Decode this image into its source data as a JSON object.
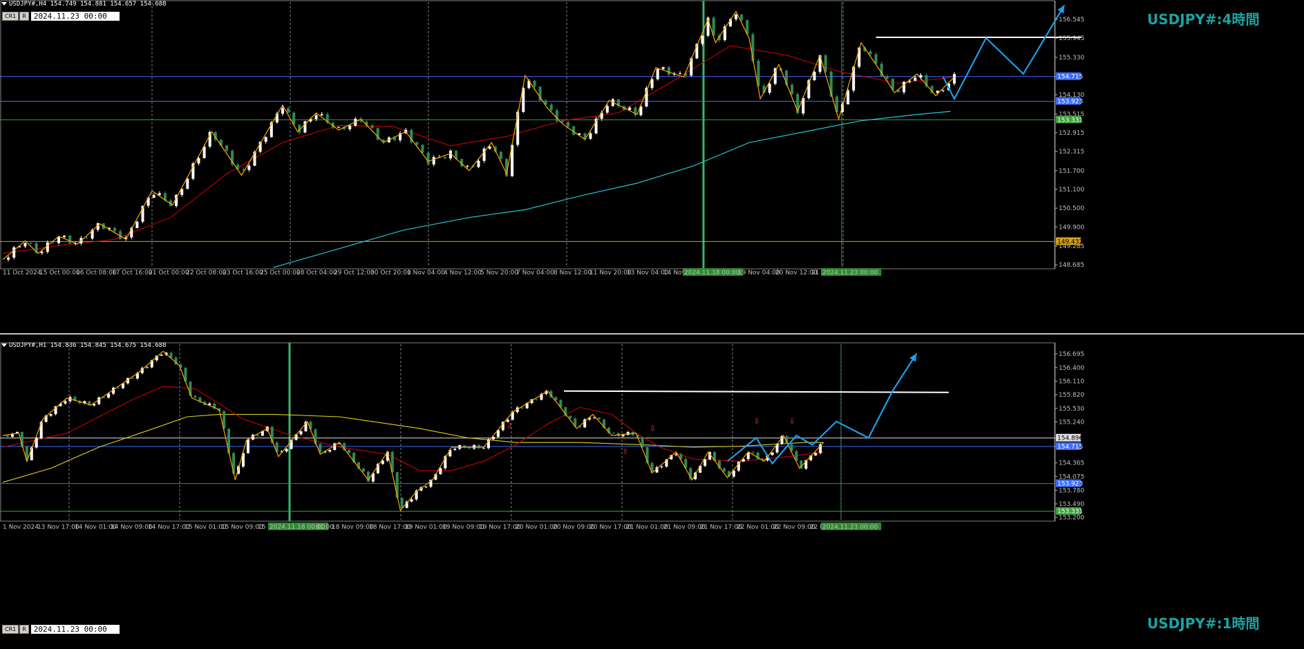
{
  "h4": {
    "header": "USDJPY#,H4  154.749 154.881 154.657 154.688",
    "buttons": [
      "CR1",
      "R"
    ],
    "date_box": "2024.11.23 00:00",
    "title": "USDJPY#:4時間"
  },
  "h1": {
    "header": "USDJPY#,H1  154.836 154.845 154.675 154.688",
    "buttons": [
      "CR1",
      "R"
    ],
    "date_box": "2024.11.23 00:00",
    "title": "USDJPY#:1時間"
  },
  "colors": {
    "background": "#000000",
    "bull": "#ffffff",
    "bear": "#2e8b57",
    "ma_red": "#cc0000",
    "ma_cyan": "#20c8d0",
    "ma_yellow": "#e0d020",
    "zigzag": "#ffa500",
    "forecast": "#1e9ee8",
    "hline_blue": "#3c6cff",
    "hline_green": "#40a040",
    "hline_gold": "#d4a017",
    "vline_green": "#3cb371",
    "title": "#1aa3a3"
  },
  "chart_data": [
    {
      "type": "candlestick",
      "symbol": "USDJPY#",
      "timeframe": "H4",
      "ylim": [
        148.6,
        157.1
      ],
      "y_ticks": [
        156.545,
        155.945,
        155.33,
        154.715,
        154.13,
        153.515,
        152.915,
        152.315,
        151.7,
        151.1,
        150.5,
        149.9,
        149.285,
        148.685
      ],
      "x_labels": [
        "11 Oct 2024",
        "15 Oct 00:00",
        "16 Oct 08:00",
        "17 Oct 16:00",
        "21 Oct 00:00",
        "22 Oct 08:00",
        "23 Oct 16:00",
        "25 Oct 00:00",
        "28 Oct 04:00",
        "29 Oct 12:00",
        "30 Oct 20:00",
        "1 Nov 04:00",
        "4 Nov 12:00",
        "5 Nov 20:00",
        "7 Nov 04:00",
        "8 Nov 12:00",
        "11 Nov 20:00",
        "13 Nov 04:00",
        "14 Nov",
        "2024.11.18 00:00",
        "19 Nov 04:00",
        "20 Nov 12:00",
        "21 N",
        "2024.11.23 00:00"
      ],
      "price_path": [
        [
          0,
          148.85
        ],
        [
          12,
          149.45
        ],
        [
          19,
          149.05
        ],
        [
          30,
          149.6
        ],
        [
          40,
          149.35
        ],
        [
          52,
          150.0
        ],
        [
          66,
          149.5
        ],
        [
          80,
          151.05
        ],
        [
          91,
          150.6
        ],
        [
          112,
          152.95
        ],
        [
          128,
          151.55
        ],
        [
          150,
          153.8
        ],
        [
          158,
          152.95
        ],
        [
          168,
          153.55
        ],
        [
          180,
          153.0
        ],
        [
          192,
          153.35
        ],
        [
          204,
          152.6
        ],
        [
          216,
          152.95
        ],
        [
          228,
          152.0
        ],
        [
          240,
          152.25
        ],
        [
          250,
          151.7
        ],
        [
          262,
          152.6
        ],
        [
          270,
          151.6
        ],
        [
          280,
          154.75
        ],
        [
          292,
          153.7
        ],
        [
          300,
          153.2
        ],
        [
          312,
          152.7
        ],
        [
          325,
          153.95
        ],
        [
          340,
          153.5
        ],
        [
          350,
          155.0
        ],
        [
          365,
          154.7
        ],
        [
          378,
          156.55
        ],
        [
          382,
          155.8
        ],
        [
          393,
          156.8
        ],
        [
          400,
          155.95
        ],
        [
          406,
          154.0
        ],
        [
          416,
          155.1
        ],
        [
          426,
          153.6
        ],
        [
          438,
          155.4
        ],
        [
          448,
          153.35
        ],
        [
          460,
          155.8
        ],
        [
          468,
          155.1
        ],
        [
          478,
          154.2
        ],
        [
          490,
          154.8
        ],
        [
          500,
          154.1
        ],
        [
          510,
          154.7
        ]
      ],
      "ma_red_path": [
        [
          0,
          149.05
        ],
        [
          30,
          149.3
        ],
        [
          60,
          149.5
        ],
        [
          90,
          150.2
        ],
        [
          120,
          151.6
        ],
        [
          150,
          152.6
        ],
        [
          180,
          153.15
        ],
        [
          210,
          153.1
        ],
        [
          240,
          152.5
        ],
        [
          270,
          152.8
        ],
        [
          300,
          153.3
        ],
        [
          330,
          153.55
        ],
        [
          360,
          154.6
        ],
        [
          390,
          155.7
        ],
        [
          420,
          155.4
        ],
        [
          450,
          154.85
        ],
        [
          480,
          154.5
        ],
        [
          510,
          154.7
        ]
      ],
      "ma_cyan_path": [
        [
          145,
          148.6
        ],
        [
          180,
          149.2
        ],
        [
          215,
          149.8
        ],
        [
          250,
          150.2
        ],
        [
          280,
          150.45
        ],
        [
          310,
          150.9
        ],
        [
          340,
          151.3
        ],
        [
          370,
          151.85
        ],
        [
          400,
          152.6
        ],
        [
          430,
          152.95
        ],
        [
          460,
          153.3
        ],
        [
          490,
          153.5
        ],
        [
          508,
          153.6
        ]
      ],
      "forecast_path": [
        [
          504,
          154.7
        ],
        [
          510,
          154.0
        ],
        [
          527,
          155.95
        ],
        [
          547,
          154.8
        ],
        [
          569,
          157.0
        ]
      ],
      "resistance_line": {
        "y": 155.97,
        "from": 468,
        "to": 578
      },
      "h_lines": [
        {
          "y": 154.715,
          "label": "154.715",
          "color": "blue"
        },
        {
          "y": 153.923,
          "label": "153.923",
          "color": "blue"
        },
        {
          "y": 153.331,
          "label": "153.331",
          "color": "green"
        },
        {
          "y": 149.432,
          "label": "149.432",
          "color": "gold"
        }
      ],
      "v_line": "2024.11.18 00:00",
      "current_time": "2024.11.23 00:00"
    },
    {
      "type": "candlestick",
      "symbol": "USDJPY#",
      "timeframe": "H1",
      "ylim": [
        153.15,
        156.9
      ],
      "y_ticks": [
        156.695,
        156.4,
        156.11,
        155.82,
        155.53,
        155.24,
        154.896,
        154.715,
        154.365,
        154.075,
        153.78,
        153.49,
        153.2
      ],
      "x_labels": [
        "1 Nov 2024",
        "13 Nov 17:00",
        "14 Nov 01:00",
        "14 Nov 09:00",
        "14 Nov 17:00",
        "15 Nov 01:00",
        "15 Nov 09:00",
        "15 N",
        "2024.11.18 00:00",
        "01:00",
        "18 Nov 09:00",
        "18 Nov 17:00",
        "19 Nov 01:00",
        "19 Nov 09:00",
        "19 Nov 17:00",
        "20 Nov 01:00",
        "20 Nov 09:00",
        "20 Nov 17:00",
        "21 Nov 01:00",
        "21 Nov 09:00",
        "21 Nov 17:00",
        "22 Nov 01:00",
        "22 Nov 09:00",
        "22 N",
        "2024.11.23 00:00"
      ],
      "price_path": [
        [
          0,
          154.95
        ],
        [
          10,
          155.0
        ],
        [
          15,
          154.4
        ],
        [
          25,
          155.3
        ],
        [
          40,
          155.75
        ],
        [
          55,
          155.6
        ],
        [
          70,
          155.95
        ],
        [
          85,
          156.3
        ],
        [
          100,
          156.75
        ],
        [
          110,
          156.45
        ],
        [
          118,
          155.75
        ],
        [
          135,
          155.5
        ],
        [
          145,
          154.0
        ],
        [
          152,
          154.85
        ],
        [
          165,
          155.1
        ],
        [
          172,
          154.5
        ],
        [
          190,
          155.25
        ],
        [
          198,
          154.55
        ],
        [
          210,
          154.8
        ],
        [
          228,
          154.0
        ],
        [
          240,
          154.6
        ],
        [
          248,
          153.35
        ],
        [
          258,
          153.75
        ],
        [
          268,
          154.0
        ],
        [
          280,
          154.7
        ],
        [
          300,
          154.7
        ],
        [
          318,
          155.45
        ],
        [
          340,
          155.9
        ],
        [
          358,
          155.1
        ],
        [
          368,
          155.4
        ],
        [
          380,
          154.95
        ],
        [
          395,
          155.0
        ],
        [
          405,
          154.15
        ],
        [
          420,
          154.6
        ],
        [
          430,
          154.0
        ],
        [
          440,
          154.6
        ],
        [
          452,
          154.05
        ],
        [
          465,
          154.6
        ],
        [
          475,
          154.4
        ],
        [
          487,
          154.95
        ],
        [
          497,
          154.25
        ],
        [
          512,
          154.8
        ]
      ],
      "ma_red_path": [
        [
          0,
          154.7
        ],
        [
          40,
          155.0
        ],
        [
          80,
          155.7
        ],
        [
          100,
          156.0
        ],
        [
          120,
          155.95
        ],
        [
          150,
          155.3
        ],
        [
          180,
          154.95
        ],
        [
          210,
          154.7
        ],
        [
          240,
          154.55
        ],
        [
          260,
          154.2
        ],
        [
          280,
          154.2
        ],
        [
          300,
          154.4
        ],
        [
          320,
          154.75
        ],
        [
          340,
          155.2
        ],
        [
          360,
          155.55
        ],
        [
          380,
          155.4
        ],
        [
          395,
          155.0
        ],
        [
          410,
          154.7
        ],
        [
          430,
          154.45
        ],
        [
          460,
          154.4
        ],
        [
          490,
          154.5
        ],
        [
          512,
          154.6
        ]
      ],
      "ma_yellow_path": [
        [
          0,
          153.95
        ],
        [
          30,
          154.25
        ],
        [
          60,
          154.7
        ],
        [
          90,
          155.05
        ],
        [
          115,
          155.35
        ],
        [
          135,
          155.4
        ],
        [
          170,
          155.4
        ],
        [
          210,
          155.35
        ],
        [
          240,
          155.2
        ],
        [
          260,
          155.1
        ],
        [
          290,
          154.9
        ],
        [
          320,
          154.8
        ],
        [
          360,
          154.8
        ],
        [
          400,
          154.75
        ],
        [
          430,
          154.7
        ],
        [
          460,
          154.72
        ],
        [
          500,
          154.8
        ],
        [
          512,
          154.8
        ]
      ],
      "forecast_path": [
        [
          452,
          154.4
        ],
        [
          470,
          154.9
        ],
        [
          480,
          154.35
        ],
        [
          495,
          154.95
        ],
        [
          505,
          154.75
        ],
        [
          520,
          155.25
        ],
        [
          540,
          154.9
        ],
        [
          555,
          155.9
        ],
        [
          570,
          156.7
        ]
      ],
      "resistance_line": {
        "y": 155.9,
        "from": 350,
        "to": 590
      },
      "arrows_down": [
        [
          316,
          155.1
        ],
        [
          405,
          155.05
        ],
        [
          470,
          155.2
        ],
        [
          492,
          155.2
        ]
      ],
      "arrows_up": [
        [
          388,
          154.55
        ]
      ],
      "h_lines": [
        {
          "y": 154.896,
          "label": "154.896",
          "color": "white"
        },
        {
          "y": 154.715,
          "label": "154.715",
          "color": "blue"
        },
        {
          "y": 153.923,
          "label": "153.923",
          "color": "blue"
        },
        {
          "y": 153.331,
          "label": "153.331",
          "color": "green"
        }
      ],
      "v_line": "2024.11.18 00:00",
      "current_time": "2024.11.23 00:00"
    }
  ]
}
